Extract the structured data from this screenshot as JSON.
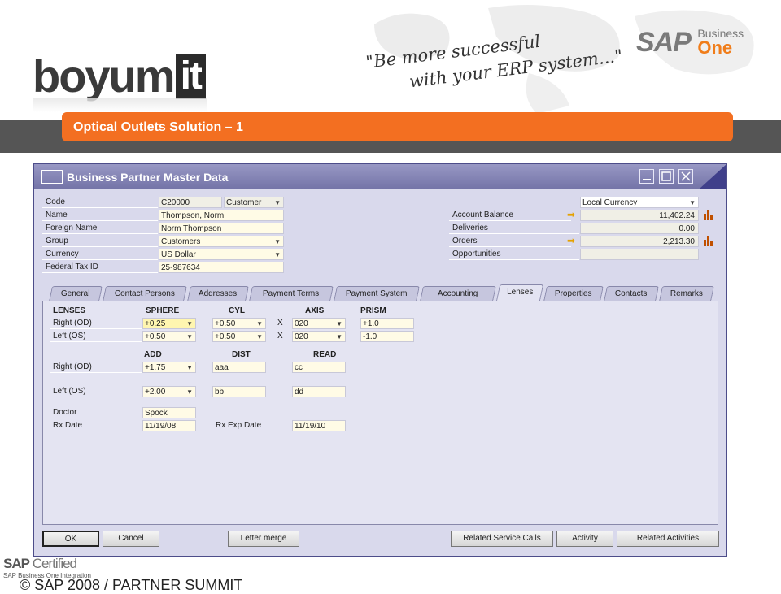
{
  "header": {
    "logo_word": "boyum",
    "logo_box": "it",
    "tagline_line1": "\"Be more successful",
    "tagline_line2": "with your ERP system...\"",
    "sap_mark": "SAP",
    "sap_text_1": "Business",
    "sap_text_2": "One",
    "slide_title": "Optical Outlets Solution – 1"
  },
  "window": {
    "title": "Business Partner Master Data",
    "fields": {
      "code_label": "Code",
      "code_value": "C20000",
      "type_value": "Customer",
      "name_label": "Name",
      "name_value": "Thompson, Norm",
      "foreign_label": "Foreign Name",
      "foreign_value": "Norm Thompson",
      "group_label": "Group",
      "group_value": "Customers",
      "currency_label": "Currency",
      "currency_value": "US Dollar",
      "tax_label": "Federal Tax ID",
      "tax_value": "25-987634",
      "local_currency": "Local Currency",
      "balance_label": "Account Balance",
      "balance_value": "11,402.24",
      "deliveries_label": "Deliveries",
      "deliveries_value": "0.00",
      "orders_label": "Orders",
      "orders_value": "2,213.30",
      "opportunities_label": "Opportunities",
      "opportunities_value": ""
    },
    "tabs": [
      "General",
      "Contact Persons",
      "Addresses",
      "Payment Terms",
      "Payment System",
      "Accounting",
      "Lenses",
      "Properties",
      "Contacts",
      "Remarks"
    ],
    "active_tab": "Lenses",
    "lenses": {
      "h_lenses": "LENSES",
      "h_sphere": "SPHERE",
      "h_cyl": "CYL",
      "h_axis": "AXIS",
      "h_prism": "PRISM",
      "right_label": "Right (OD)",
      "left_label": "Left   (OS)",
      "right_sphere": "+0.25",
      "right_cyl": "+0.50",
      "right_x": "X",
      "right_axis": "020",
      "right_prism": "+1.0",
      "left_sphere": "+0.50",
      "left_cyl": "+0.50",
      "left_x": "X",
      "left_axis": "020",
      "left_prism": "-1.0",
      "h_add": "ADD",
      "h_dist": "DIST",
      "h_read": "READ",
      "right2_label": "Right (OD)",
      "right_add": "+1.75",
      "right_dist": "aaa",
      "right_read": "cc",
      "left2_label": "Left   (OS)",
      "left_add": "+2.00",
      "left_dist": "bb",
      "left_read": "dd",
      "doctor_label": "Doctor",
      "doctor_value": "Spock",
      "rxdate_label": "Rx Date",
      "rxdate_value": "11/19/08",
      "rxexp_label": "Rx Exp Date",
      "rxexp_value": "11/19/10"
    },
    "buttons": {
      "ok": "OK",
      "cancel": "Cancel",
      "letter_merge": "Letter merge",
      "related_service_calls": "Related Service Calls",
      "activity": "Activity",
      "related_activities": "Related Activities"
    }
  },
  "footer": {
    "cert_sap": "SAP",
    "cert_word": "Certified",
    "cert_sub": "SAP Business One Integration",
    "copyright": "© SAP 2008 / PARTNER SUMMIT"
  },
  "colors": {
    "orange": "#f36f21",
    "window_bg": "#d9d9ec",
    "titlebar": "#7474a8",
    "field_bg": "#fffbe6"
  }
}
